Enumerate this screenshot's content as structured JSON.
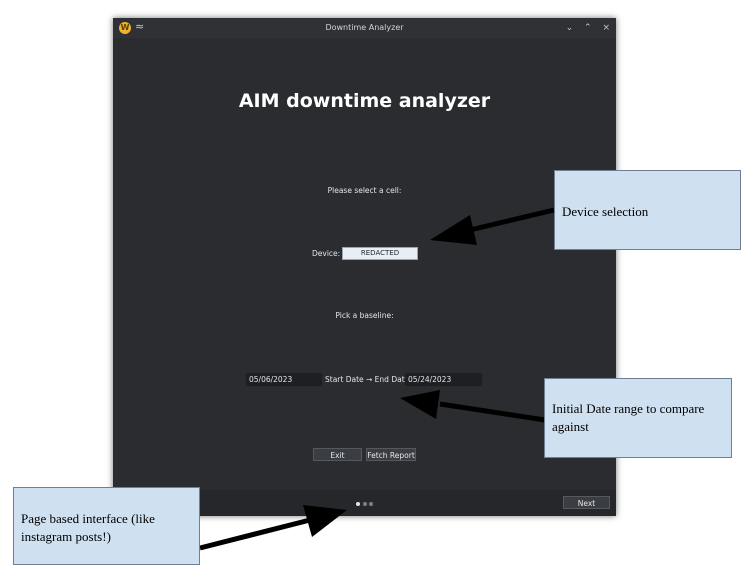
{
  "window": {
    "title": "Downtime Analyzer",
    "app_icon": "W",
    "shade_icon": "≈",
    "controls": {
      "minimize": "⌄",
      "maximize": "⌃",
      "close": "×"
    }
  },
  "heading": "AIM downtime analyzer",
  "cell_prompt": "Please select a cell:",
  "device": {
    "label": "Device:",
    "value": "REDACTED"
  },
  "baseline_prompt": "Pick a baseline:",
  "dates": {
    "start": "05/06/2023",
    "separator": "Start Date → End Date",
    "end": "05/24/2023"
  },
  "buttons": {
    "exit": "Exit",
    "fetch": "Fetch Report",
    "next": "Next"
  },
  "pager": {
    "count": 3,
    "active_index": 0
  },
  "annotations": {
    "device": "Device selection",
    "dates": "Initial Date range to compare against",
    "pages": "Page based interface (like instagram posts!)"
  },
  "colors": {
    "window_bg": "#2a2c30",
    "callout_bg": "#cfe0f1",
    "arrow": "#000000"
  }
}
